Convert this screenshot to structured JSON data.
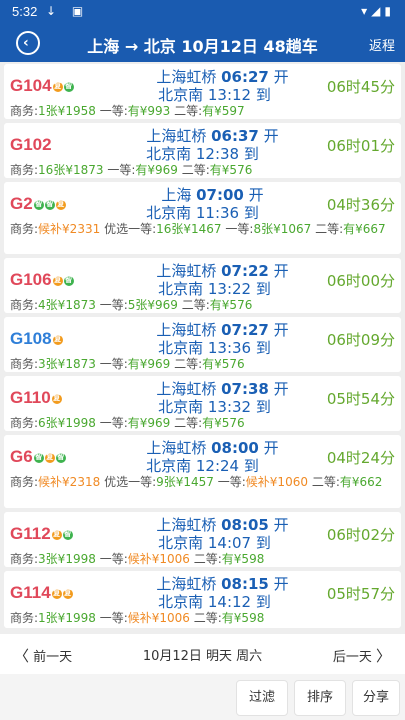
{
  "status_bar": {
    "time": "5:32"
  },
  "header": {
    "title": "上海 → 北京 10月12日 48趟车",
    "return_label": "返程"
  },
  "trains": [
    {
      "code": "G104",
      "badges": [
        "o",
        "g"
      ],
      "from": "上海虹桥",
      "dep_time": "06:27",
      "dep_suffix": "开",
      "to": "北京南",
      "arr_time": "13:12",
      "arr_suffix": "到",
      "duration": "06时45分",
      "seats": [
        {
          "label": "商务:",
          "value": "1张¥1958",
          "status": "ok"
        },
        {
          "label": "一等:",
          "value": "有¥993",
          "status": "ok"
        },
        {
          "label": "二等:",
          "value": "有¥597",
          "status": "ok"
        }
      ]
    },
    {
      "code": "G102",
      "badges": [],
      "from": "上海虹桥",
      "dep_time": "06:37",
      "dep_suffix": "开",
      "to": "北京南",
      "arr_time": "12:38",
      "arr_suffix": "到",
      "duration": "06时01分",
      "seats": [
        {
          "label": "商务:",
          "value": "16张¥1873",
          "status": "ok"
        },
        {
          "label": "一等:",
          "value": "有¥969",
          "status": "ok"
        },
        {
          "label": "二等:",
          "value": "有¥576",
          "status": "ok"
        }
      ]
    },
    {
      "code": "G2",
      "badges": [
        "g",
        "g",
        "o"
      ],
      "from": "上海",
      "dep_time": "07:00",
      "dep_suffix": "开",
      "to": "北京南",
      "arr_time": "11:36",
      "arr_suffix": "到",
      "duration": "04时36分",
      "seats": [
        {
          "label": "商务:",
          "value": "候补¥2331",
          "status": "wait"
        },
        {
          "label": "优选一等:",
          "value": "16张¥1467",
          "status": "ok"
        },
        {
          "label": "一等:",
          "value": "8张¥1067",
          "status": "ok"
        },
        {
          "label": "二等:",
          "value": "有¥667",
          "status": "ok"
        }
      ]
    },
    {
      "code": "G106",
      "badges": [
        "o",
        "g"
      ],
      "from": "上海虹桥",
      "dep_time": "07:22",
      "dep_suffix": "开",
      "to": "北京南",
      "arr_time": "13:22",
      "arr_suffix": "到",
      "duration": "06时00分",
      "seats": [
        {
          "label": "商务:",
          "value": "4张¥1873",
          "status": "ok"
        },
        {
          "label": "一等:",
          "value": "5张¥969",
          "status": "ok"
        },
        {
          "label": "二等:",
          "value": "有¥576",
          "status": "ok"
        }
      ]
    },
    {
      "code": "G108",
      "badges": [
        "o"
      ],
      "from": "上海虹桥",
      "dep_time": "07:27",
      "dep_suffix": "开",
      "to": "北京南",
      "arr_time": "13:36",
      "arr_suffix": "到",
      "duration": "06时09分",
      "seats": [
        {
          "label": "商务:",
          "value": "3张¥1873",
          "status": "ok"
        },
        {
          "label": "一等:",
          "value": "有¥969",
          "status": "ok"
        },
        {
          "label": "二等:",
          "value": "有¥576",
          "status": "ok"
        }
      ]
    },
    {
      "code": "G110",
      "badges": [
        "o"
      ],
      "from": "上海虹桥",
      "dep_time": "07:38",
      "dep_suffix": "开",
      "to": "北京南",
      "arr_time": "13:32",
      "arr_suffix": "到",
      "duration": "05时54分",
      "seats": [
        {
          "label": "商务:",
          "value": "6张¥1998",
          "status": "ok"
        },
        {
          "label": "一等:",
          "value": "有¥969",
          "status": "ok"
        },
        {
          "label": "二等:",
          "value": "有¥576",
          "status": "ok"
        }
      ]
    },
    {
      "code": "G6",
      "badges": [
        "g",
        "o",
        "g"
      ],
      "from": "上海虹桥",
      "dep_time": "08:00",
      "dep_suffix": "开",
      "to": "北京南",
      "arr_time": "12:24",
      "arr_suffix": "到",
      "duration": "04时24分",
      "seats": [
        {
          "label": "商务:",
          "value": "候补¥2318",
          "status": "wait"
        },
        {
          "label": "优选一等:",
          "value": "9张¥1457",
          "status": "ok"
        },
        {
          "label": "一等:",
          "value": "候补¥1060",
          "status": "wait"
        },
        {
          "label": "二等:",
          "value": "有¥662",
          "status": "ok"
        }
      ]
    },
    {
      "code": "G112",
      "badges": [
        "o",
        "g"
      ],
      "from": "上海虹桥",
      "dep_time": "08:05",
      "dep_suffix": "开",
      "to": "北京南",
      "arr_time": "14:07",
      "arr_suffix": "到",
      "duration": "06时02分",
      "seats": [
        {
          "label": "商务:",
          "value": "3张¥1998",
          "status": "ok"
        },
        {
          "label": "一等:",
          "value": "候补¥1006",
          "status": "wait"
        },
        {
          "label": "二等:",
          "value": "有¥598",
          "status": "ok"
        }
      ]
    },
    {
      "code": "G114",
      "badges": [
        "o",
        "o"
      ],
      "from": "上海虹桥",
      "dep_time": "08:15",
      "dep_suffix": "开",
      "to": "北京南",
      "arr_time": "14:12",
      "arr_suffix": "到",
      "duration": "05时57分",
      "seats": [
        {
          "label": "商务:",
          "value": "1张¥1998",
          "status": "ok"
        },
        {
          "label": "一等:",
          "value": "候补¥1006",
          "status": "wait"
        },
        {
          "label": "二等:",
          "value": "有¥598",
          "status": "ok"
        }
      ]
    }
  ],
  "footer": {
    "prev_label": "前一天",
    "date_label": "10月12日 明天 周六",
    "next_label": "后一天",
    "filter_label": "过滤",
    "sort_label": "排序",
    "share_label": "分享"
  },
  "colors": {
    "primary": "#1a5bb0",
    "code_red": "#e0485a",
    "code_blue": "#2f7fd8",
    "duration_green": "#64a82e",
    "available_green": "#4aa830",
    "waitlist_orange": "#f08a24"
  },
  "icons": {
    "back": "back-circle-icon",
    "prev": "chevron-left-icon",
    "next": "chevron-right-icon"
  }
}
